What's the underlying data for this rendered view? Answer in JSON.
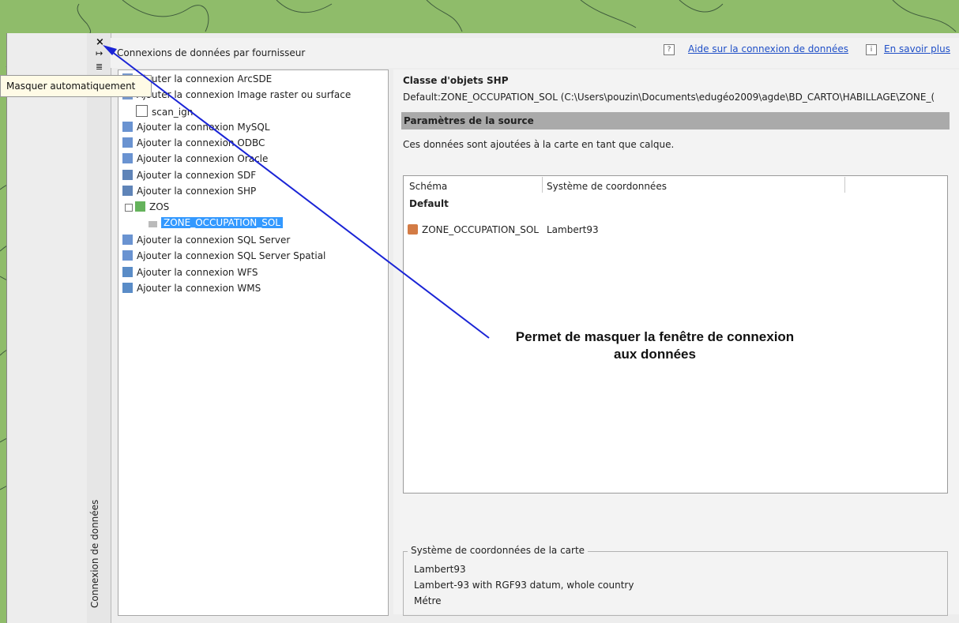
{
  "dock": {
    "title": "Connexion de données",
    "close_icon": "×",
    "pin_icon": "↦",
    "menu_icon": "≣",
    "tooltip": "Masquer automatiquement"
  },
  "header": {
    "title": "Connexions de données par fournisseur",
    "help_label": "Aide sur la connexion de données",
    "info_label": "En savoir plus",
    "help_icon": "?",
    "info_icon": "i"
  },
  "tree": {
    "items": [
      {
        "label": "Ajouter la connexion ArcSDE"
      },
      {
        "label": "Ajouter la connexion Image raster ou surface"
      },
      {
        "label": "scan_ign"
      },
      {
        "label": "Ajouter la connexion MySQL"
      },
      {
        "label": "Ajouter la connexion ODBC"
      },
      {
        "label": "Ajouter la connexion Oracle"
      },
      {
        "label": "Ajouter la connexion SDF"
      },
      {
        "label": "Ajouter la connexion SHP"
      },
      {
        "label": "ZOS"
      },
      {
        "label": "ZONE_OCCUPATION_SOL"
      },
      {
        "label": "Ajouter la connexion SQL Server"
      },
      {
        "label": "Ajouter la connexion SQL Server Spatial"
      },
      {
        "label": "Ajouter la connexion WFS"
      },
      {
        "label": "Ajouter la connexion WMS"
      }
    ]
  },
  "details": {
    "class_title": "Classe d'objets SHP",
    "path": "Default:ZONE_OCCUPATION_SOL (C:\\Users\\pouzin\\Documents\\edugéo2009\\agde\\BD_CARTO\\HABILLAGE\\ZONE_(",
    "source_header": "Paramètres de la source",
    "source_desc": "Ces données sont ajoutées à la carte en tant que calque.",
    "table_headers": [
      "Schéma",
      "Système de coordonnées"
    ],
    "group": "Default",
    "row_name": "ZONE_OCCUPATION_SOL",
    "row_cs": "Lambert93",
    "annotation_line1": "Permet de masquer la fenêtre de connexion",
    "annotation_line2": "aux données",
    "coord_title": "Système de coordonnées de la carte",
    "coord_lines": [
      "Lambert93",
      "Lambert-93 with RGF93 datum, whole country",
      "Métre"
    ]
  },
  "colors": {
    "map": "#8fbc6a",
    "arrow": "#1a24d6",
    "selection": "#3399ff"
  }
}
